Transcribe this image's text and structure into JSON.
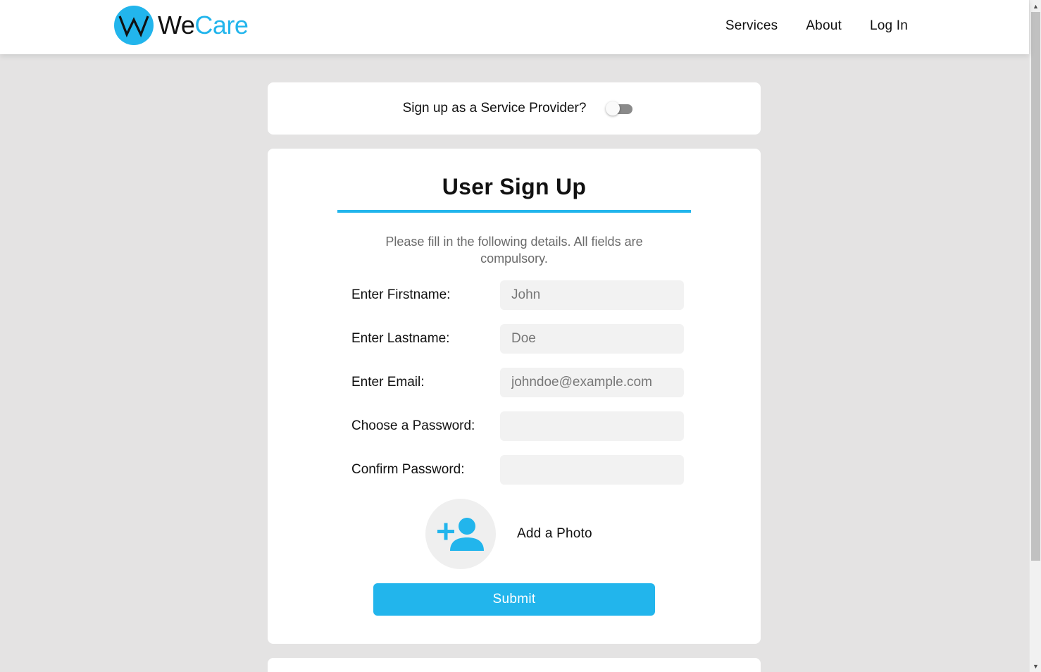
{
  "header": {
    "logo_letter": "W",
    "logo_text_we": "We",
    "logo_text_care": "Care",
    "nav": [
      {
        "label": "Services"
      },
      {
        "label": "About"
      },
      {
        "label": "Log In"
      }
    ]
  },
  "provider_toggle": {
    "label": "Sign up as a Service Provider?",
    "checked": false
  },
  "form": {
    "title": "User Sign Up",
    "subtitle": "Please fill in the following details. All fields are compulsory.",
    "fields": [
      {
        "label": "Enter Firstname:",
        "placeholder": "John",
        "value": ""
      },
      {
        "label": "Enter Lastname:",
        "placeholder": "Doe",
        "value": ""
      },
      {
        "label": "Enter Email:",
        "placeholder": "johndoe@example.com",
        "value": ""
      },
      {
        "label": "Choose a Password:",
        "placeholder": "",
        "value": ""
      },
      {
        "label": "Confirm Password:",
        "placeholder": "",
        "value": ""
      }
    ],
    "photo_icon": "add-user-icon",
    "photo_label": "Add a Photo",
    "submit_label": "Submit"
  },
  "colors": {
    "accent": "#22b5ec",
    "background": "#e4e3e3",
    "card": "#ffffff",
    "input_bg": "#f2f2f2"
  }
}
